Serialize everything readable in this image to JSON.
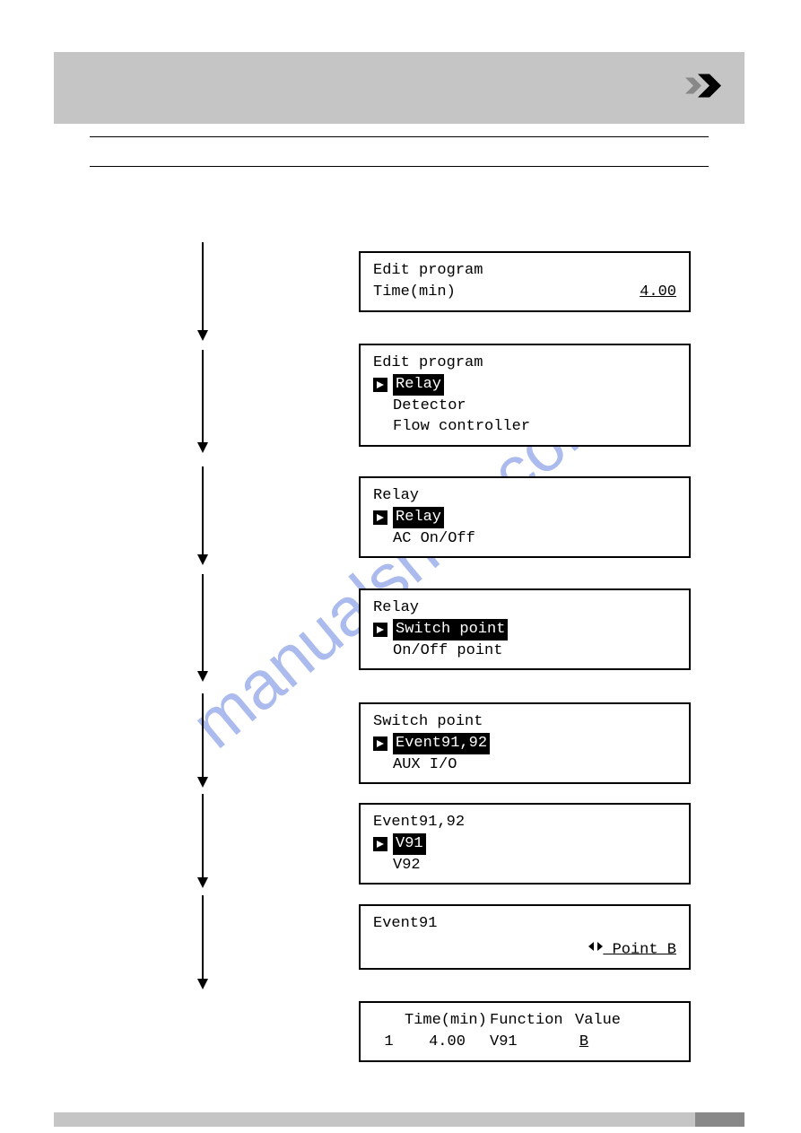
{
  "watermark": "manualshire.com",
  "panel1": {
    "line1": "Edit program",
    "label": "Time(min)",
    "value": "4.00"
  },
  "panel2": {
    "line1": "Edit program",
    "selected": "Relay",
    "item2": "Detector",
    "item3": "Flow controller"
  },
  "panel3": {
    "title": "Relay",
    "selected": "Relay",
    "item2": "AC On/Off"
  },
  "panel4": {
    "title": "Relay",
    "selected": "Switch point",
    "item2": "On/Off point"
  },
  "panel5": {
    "title": "Switch point",
    "selected": "Event91,92",
    "item2": "AUX I/O"
  },
  "panel6": {
    "title": "Event91,92",
    "selected": "V91",
    "item2": "V92"
  },
  "panel7": {
    "title": "Event91",
    "value": " Point B"
  },
  "panel8": {
    "header_time": "Time(min)",
    "header_func": "Function",
    "header_value": "Value",
    "row_index": "1",
    "row_time": "4.00",
    "row_func": "V91",
    "row_value": "B"
  }
}
